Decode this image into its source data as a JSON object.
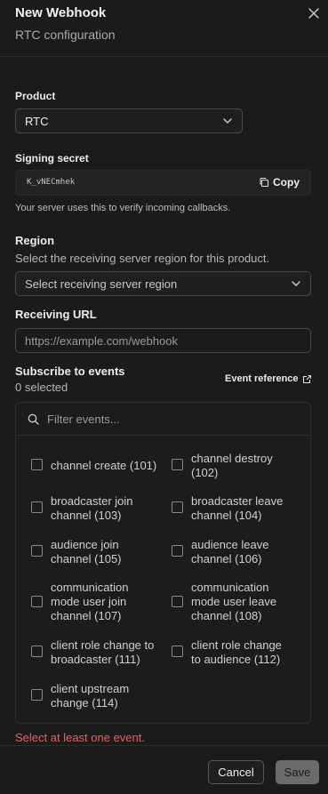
{
  "header": {
    "title": "New Webhook",
    "subtitle": "RTC configuration"
  },
  "product": {
    "label": "Product",
    "value": "RTC"
  },
  "secret": {
    "label": "Signing secret",
    "value": "K_vNECmhek",
    "copy_label": "Copy",
    "helper": "Your server uses this to verify incoming callbacks."
  },
  "region": {
    "label": "Region",
    "description": "Select the receiving server region for this product.",
    "placeholder": "Select receiving server region"
  },
  "url": {
    "label": "Receiving URL",
    "placeholder": "https://example.com/webhook"
  },
  "events": {
    "label": "Subscribe to events",
    "selected_count": "0 selected",
    "reference_label": "Event reference",
    "filter_placeholder": "Filter events...",
    "items": [
      {
        "label": "channel create (101)",
        "checked": false
      },
      {
        "label": "channel destroy (102)",
        "checked": false
      },
      {
        "label": "broadcaster join channel (103)",
        "checked": false
      },
      {
        "label": "broadcaster leave channel (104)",
        "checked": false
      },
      {
        "label": "audience join channel (105)",
        "checked": false
      },
      {
        "label": "audience leave channel (106)",
        "checked": false
      },
      {
        "label": "communication mode user join channel (107)",
        "checked": false
      },
      {
        "label": "communication mode user leave channel (108)",
        "checked": false
      },
      {
        "label": "client role change to broadcaster (111)",
        "checked": false
      },
      {
        "label": "client role change to audience (112)",
        "checked": false
      },
      {
        "label": "client upstream change (114)",
        "checked": false
      }
    ]
  },
  "error": "Select at least one event.",
  "footer": {
    "cancel": "Cancel",
    "save": "Save"
  },
  "colors": {
    "background": "#1b1b1b",
    "error": "#e06464",
    "save_disabled": "#6b6b6b"
  }
}
